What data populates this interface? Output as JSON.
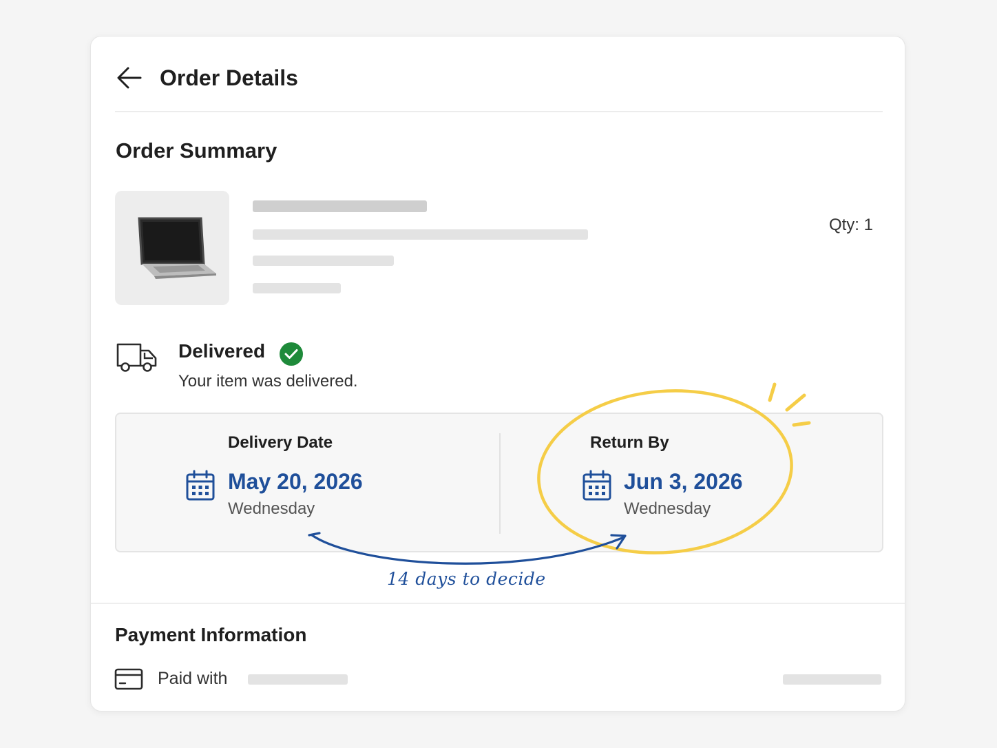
{
  "header": {
    "back_icon": "arrow-left-icon",
    "title": "Order Details"
  },
  "order_summary": {
    "title": "Order Summary",
    "product_image": "laptop-image",
    "qty_label": "Qty: 1"
  },
  "status": {
    "icon": "delivery-truck-icon",
    "title": "Delivered",
    "check_icon": "check-circle-icon",
    "subtitle": "Your item was delivered."
  },
  "dates": {
    "delivery": {
      "label": "Delivery Date",
      "icon": "calendar-icon",
      "date": "May 20, 2026",
      "day": "Wednesday"
    },
    "return": {
      "label": "Return By",
      "icon": "calendar-icon",
      "date": "Jun 3, 2026",
      "day": "Wednesday"
    }
  },
  "annotation": {
    "note": "14 days to decide",
    "circle_color": "#f5cd47",
    "arrow_color": "#1f4f9a"
  },
  "payment": {
    "title": "Payment Information",
    "icon": "credit-card-icon",
    "paid_with_label": "Paid with"
  },
  "colors": {
    "accent_blue": "#1f4f9a",
    "success_green": "#1e8a3a",
    "highlight_yellow": "#f5cd47"
  }
}
